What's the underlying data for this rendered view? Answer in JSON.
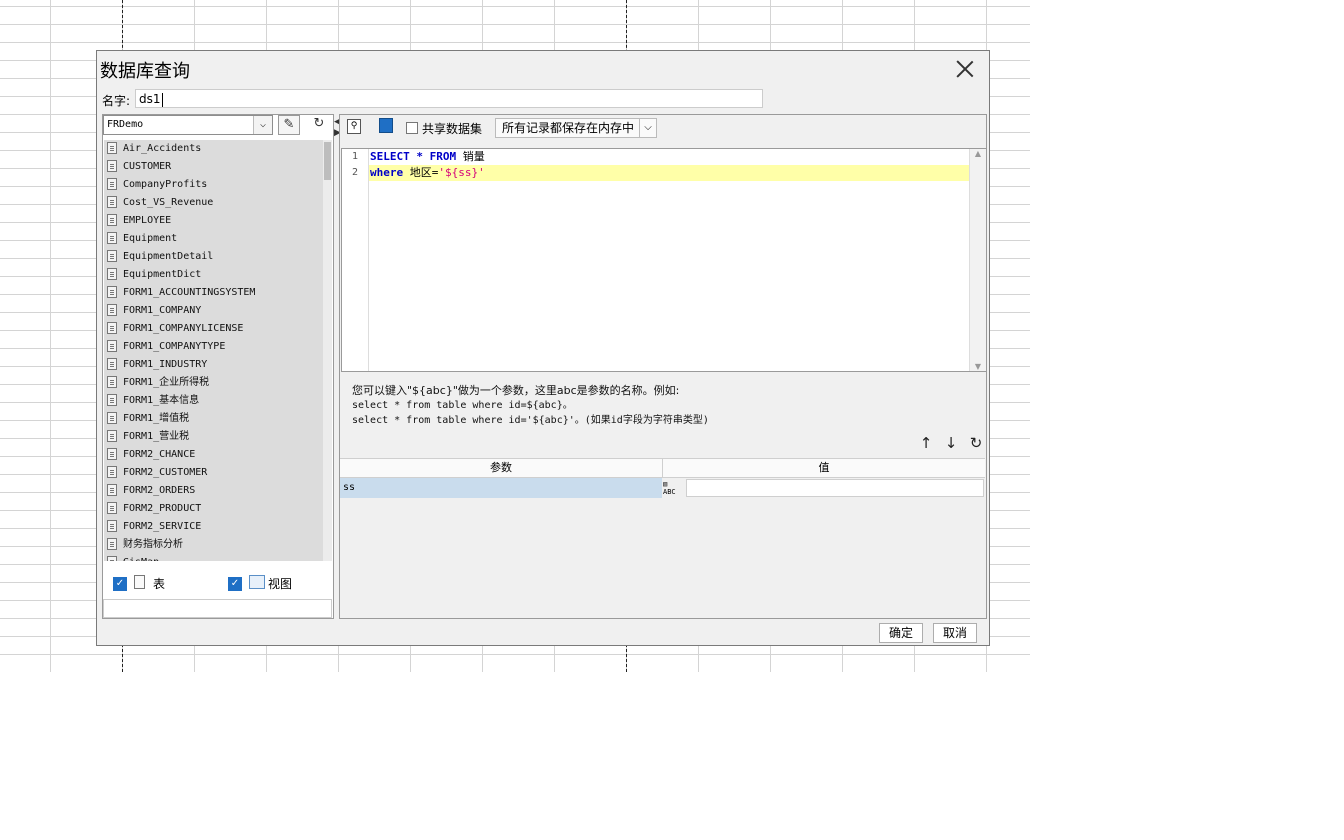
{
  "dialog": {
    "title": "数据库查询",
    "name_label": "名字:",
    "name_value": "ds1"
  },
  "left": {
    "connection": "FRDemo",
    "tables": [
      "Air_Accidents",
      "CUSTOMER",
      "CompanyProfits",
      "Cost_VS_Revenue",
      "EMPLOYEE",
      "Equipment",
      "EquipmentDetail",
      "EquipmentDict",
      "FORM1_ACCOUNTINGSYSTEM",
      "FORM1_COMPANY",
      "FORM1_COMPANYLICENSE",
      "FORM1_COMPANYTYPE",
      "FORM1_INDUSTRY",
      "FORM1_企业所得税",
      "FORM1_基本信息",
      "FORM1_增值税",
      "FORM1_营业税",
      "FORM2_CHANCE",
      "FORM2_CUSTOMER",
      "FORM2_ORDERS",
      "FORM2_PRODUCT",
      "FORM2_SERVICE",
      "财务指标分析",
      "GisMap"
    ],
    "table_check_label": "表",
    "view_check_label": "视图"
  },
  "toolbar": {
    "share_label": "共享数据集",
    "memory_option": "所有记录都保存在内存中"
  },
  "editor": {
    "line_numbers": [
      "1",
      "2"
    ]
  },
  "hint": {
    "line1": "您可以键入\"${abc}\"做为一个参数，这里abc是参数的名称。例如:",
    "line2": "select * from table where id=${abc}。",
    "line3": "select * from table where id='${abc}'。(如果id字段为字符串类型)"
  },
  "params": {
    "col_param": "参数",
    "col_value": "值",
    "rows": [
      {
        "name": "ss",
        "type_icon": "ABC"
      }
    ]
  },
  "footer": {
    "ok": "确定",
    "cancel": "取消"
  }
}
